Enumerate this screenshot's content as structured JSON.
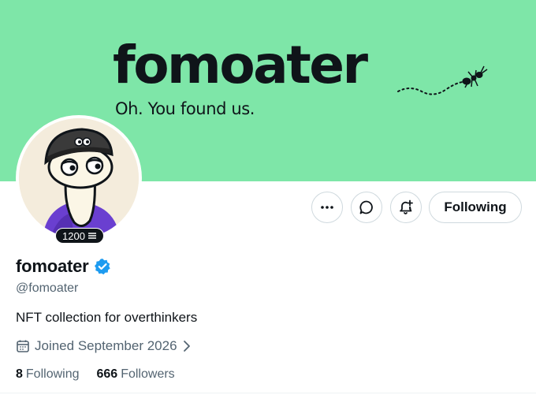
{
  "banner": {
    "title": "fomoater",
    "tagline": "Oh. You found us.",
    "background_color": "#7ee6a8"
  },
  "avatar": {
    "badge_value": "1200",
    "badge_icon": "stack-icon"
  },
  "actions": {
    "more_icon": "more-dots-icon",
    "message_icon": "message-bubble-icon",
    "notify_icon": "bell-plus-icon",
    "follow_label": "Following"
  },
  "profile": {
    "display_name": "fomoater",
    "verified_icon": "verified-badge-icon",
    "verified_color": "#1d9bf0",
    "handle": "@fomoater",
    "bio": "NFT collection for overthinkers",
    "joined": "Joined September 2026"
  },
  "stats": {
    "following_count": "8",
    "following_label": "Following",
    "followers_count": "666",
    "followers_label": "Followers"
  }
}
